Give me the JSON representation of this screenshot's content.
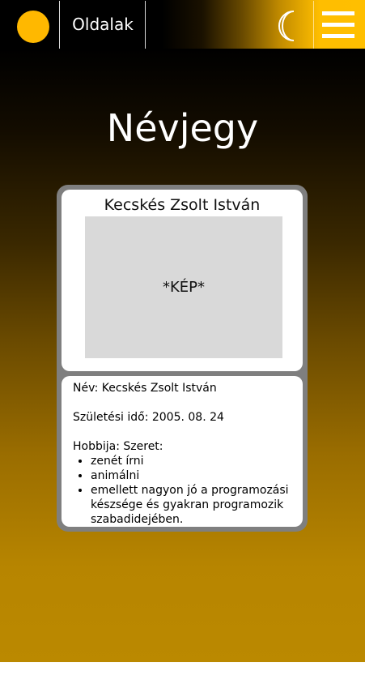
{
  "navbar": {
    "pages_link": "Oldalak",
    "theme_toggle_icon": "moon-icon",
    "menu_icon": "hamburger-menu-icon",
    "logo_color": "#ffb800"
  },
  "main": {
    "title": "Névjegy"
  },
  "card": {
    "name": "Kecskés Zsolt István",
    "photo_placeholder": "*KÉP*",
    "details": {
      "name_line": "Név: Kecskés Zsolt István",
      "birth_line": "Születési idő: 2005. 08. 24",
      "hobby_heading": "Hobbija: Szeret:",
      "hobbies": [
        "zenét írni",
        "animálni",
        "emellett nagyon jó a programozási készsége és gyakran programozik szabadidejében."
      ]
    }
  },
  "colors": {
    "accent": "#ffbf00",
    "card_border": "#7f7f7f",
    "photo_bg": "#d9d9d9"
  }
}
